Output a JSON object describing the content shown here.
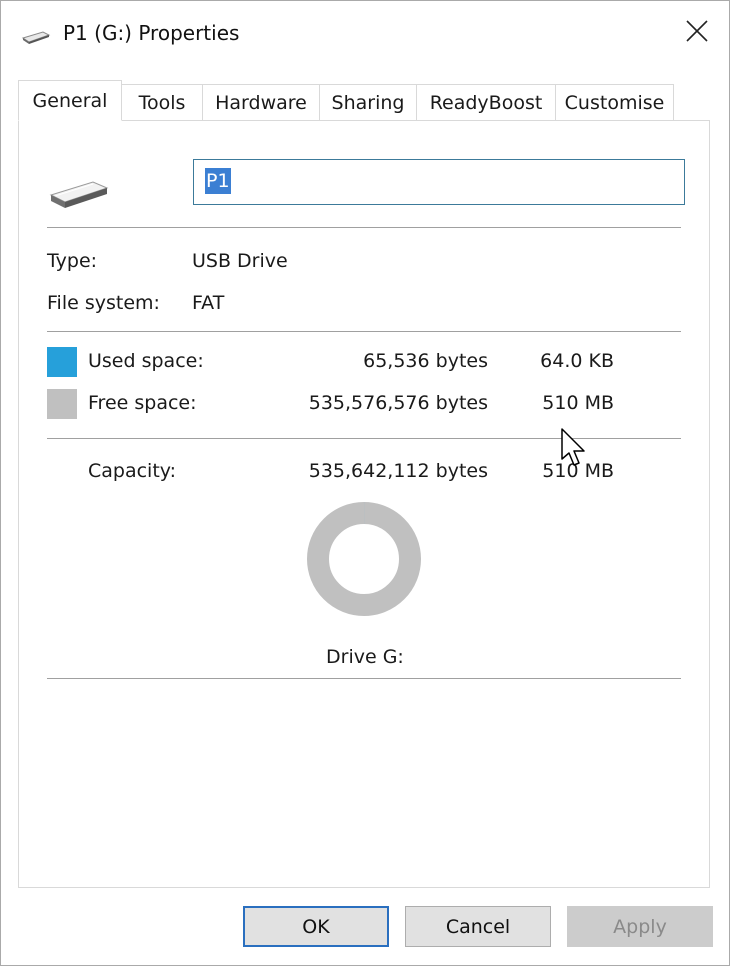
{
  "window": {
    "title": "P1 (G:) Properties"
  },
  "tabs": [
    {
      "label": "General",
      "active": true
    },
    {
      "label": "Tools",
      "active": false
    },
    {
      "label": "Hardware",
      "active": false
    },
    {
      "label": "Sharing",
      "active": false
    },
    {
      "label": "ReadyBoost",
      "active": false
    },
    {
      "label": "Customise",
      "active": false
    }
  ],
  "general": {
    "name_value": "P1",
    "type_label": "Type:",
    "type_value": "USB Drive",
    "fs_label": "File system:",
    "fs_value": "FAT",
    "used_label": "Used space:",
    "used_bytes": "65,536 bytes",
    "used_size": "64.0 KB",
    "free_label": "Free space:",
    "free_bytes": "535,576,576 bytes",
    "free_size": "510 MB",
    "capacity_label": "Capacity:",
    "capacity_bytes": "535,642,112 bytes",
    "capacity_size": "510 MB",
    "drive_label": "Drive G:"
  },
  "colors": {
    "used": "#26a0da",
    "free": "#c0c0c0"
  },
  "chart_data": {
    "type": "pie",
    "categories": [
      "Used space",
      "Free space"
    ],
    "values": [
      65536,
      535576576
    ]
  },
  "buttons": {
    "ok": "OK",
    "cancel": "Cancel",
    "apply": "Apply"
  },
  "icons": {
    "title": "usb-drive-icon",
    "close": "close-icon",
    "drive": "usb-drive-icon",
    "cursor": "mouse-pointer-icon"
  }
}
